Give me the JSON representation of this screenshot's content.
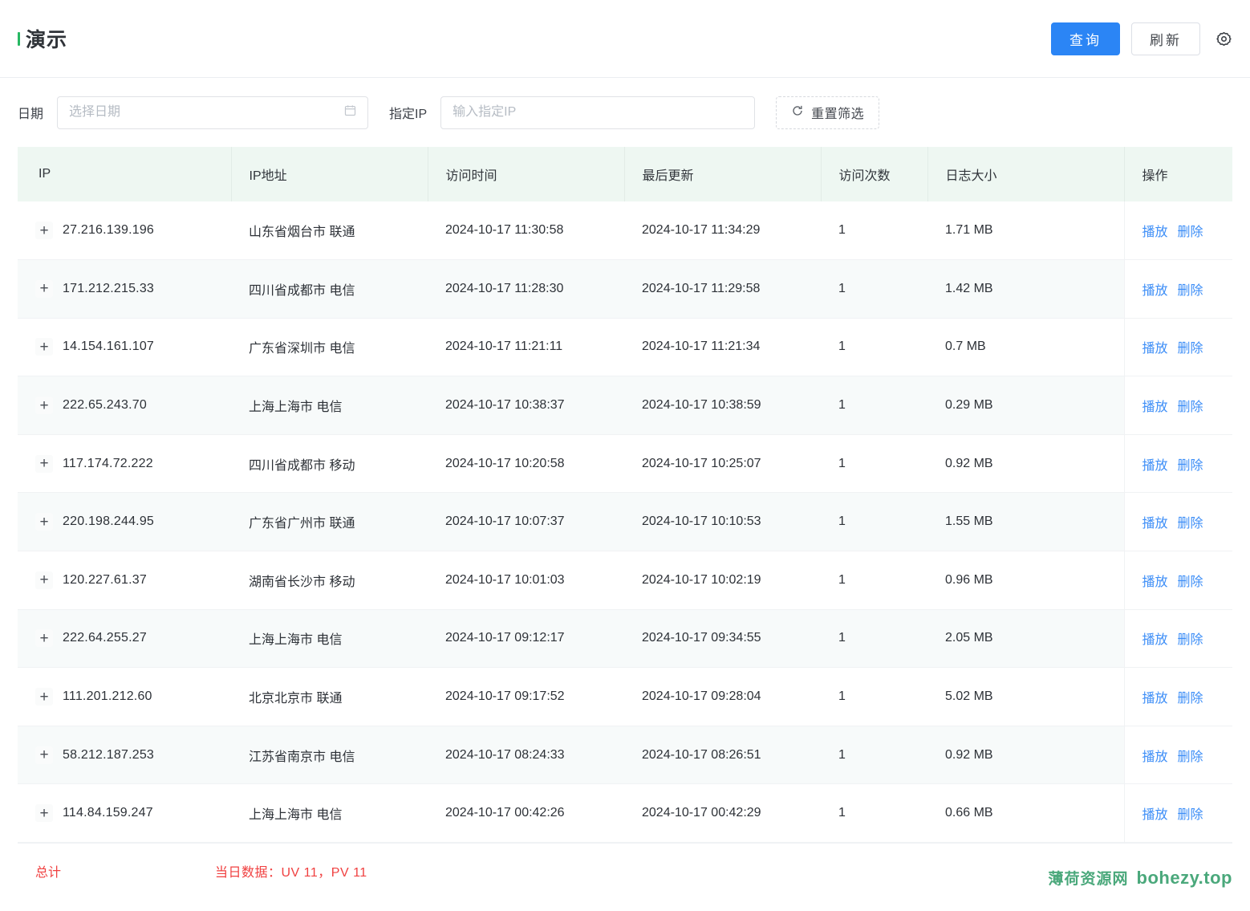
{
  "header": {
    "title": "演示",
    "accent_color": "#27b863",
    "query_label": "查询",
    "refresh_label": "刷新",
    "settings_icon": "gear-icon",
    "primary_color": "#2b85f5"
  },
  "filters": {
    "date_label": "日期",
    "date_placeholder": "选择日期",
    "date_value": "",
    "date_icon": "calendar-icon",
    "ip_label": "指定IP",
    "ip_placeholder": "输入指定IP",
    "ip_value": "",
    "reset_label": "重置筛选",
    "reset_icon": "reset-icon"
  },
  "table": {
    "columns": [
      {
        "key": "ip",
        "label": "IP"
      },
      {
        "key": "location",
        "label": "IP地址"
      },
      {
        "key": "visit",
        "label": "访问时间"
      },
      {
        "key": "updated",
        "label": "最后更新"
      },
      {
        "key": "count",
        "label": "访问次数"
      },
      {
        "key": "size",
        "label": "日志大小"
      },
      {
        "key": "ops",
        "label": "操作"
      }
    ],
    "expand_icon": "plus-icon",
    "op_play": "播放",
    "op_delete": "删除",
    "rows": [
      {
        "ip": "27.216.139.196",
        "location": "山东省烟台市 联通",
        "visit": "2024-10-17 11:30:58",
        "updated": "2024-10-17 11:34:29",
        "count": "1",
        "size": "1.71 MB"
      },
      {
        "ip": "171.212.215.33",
        "location": "四川省成都市 电信",
        "visit": "2024-10-17 11:28:30",
        "updated": "2024-10-17 11:29:58",
        "count": "1",
        "size": "1.42 MB"
      },
      {
        "ip": "14.154.161.107",
        "location": "广东省深圳市 电信",
        "visit": "2024-10-17 11:21:11",
        "updated": "2024-10-17 11:21:34",
        "count": "1",
        "size": "0.7 MB"
      },
      {
        "ip": "222.65.243.70",
        "location": "上海上海市 电信",
        "visit": "2024-10-17 10:38:37",
        "updated": "2024-10-17 10:38:59",
        "count": "1",
        "size": "0.29 MB"
      },
      {
        "ip": "117.174.72.222",
        "location": "四川省成都市 移动",
        "visit": "2024-10-17 10:20:58",
        "updated": "2024-10-17 10:25:07",
        "count": "1",
        "size": "0.92 MB"
      },
      {
        "ip": "220.198.244.95",
        "location": "广东省广州市 联通",
        "visit": "2024-10-17 10:07:37",
        "updated": "2024-10-17 10:10:53",
        "count": "1",
        "size": "1.55 MB"
      },
      {
        "ip": "120.227.61.37",
        "location": "湖南省长沙市 移动",
        "visit": "2024-10-17 10:01:03",
        "updated": "2024-10-17 10:02:19",
        "count": "1",
        "size": "0.96 MB"
      },
      {
        "ip": "222.64.255.27",
        "location": "上海上海市 电信",
        "visit": "2024-10-17 09:12:17",
        "updated": "2024-10-17 09:34:55",
        "count": "1",
        "size": "2.05 MB"
      },
      {
        "ip": "111.201.212.60",
        "location": "北京北京市 联通",
        "visit": "2024-10-17 09:17:52",
        "updated": "2024-10-17 09:28:04",
        "count": "1",
        "size": "5.02 MB"
      },
      {
        "ip": "58.212.187.253",
        "location": "江苏省南京市 电信",
        "visit": "2024-10-17 08:24:33",
        "updated": "2024-10-17 08:26:51",
        "count": "1",
        "size": "0.92 MB"
      },
      {
        "ip": "114.84.159.247",
        "location": "上海上海市 电信",
        "visit": "2024-10-17 00:42:26",
        "updated": "2024-10-17 00:42:29",
        "count": "1",
        "size": "0.66 MB"
      }
    ]
  },
  "summary": {
    "total_label": "总计",
    "daily_label": "当日数据：UV 11，PV 11",
    "color": "#f04040"
  },
  "watermark": {
    "cn": "薄荷资源网",
    "en": "bohezy.top",
    "color": "#4aa87b"
  }
}
